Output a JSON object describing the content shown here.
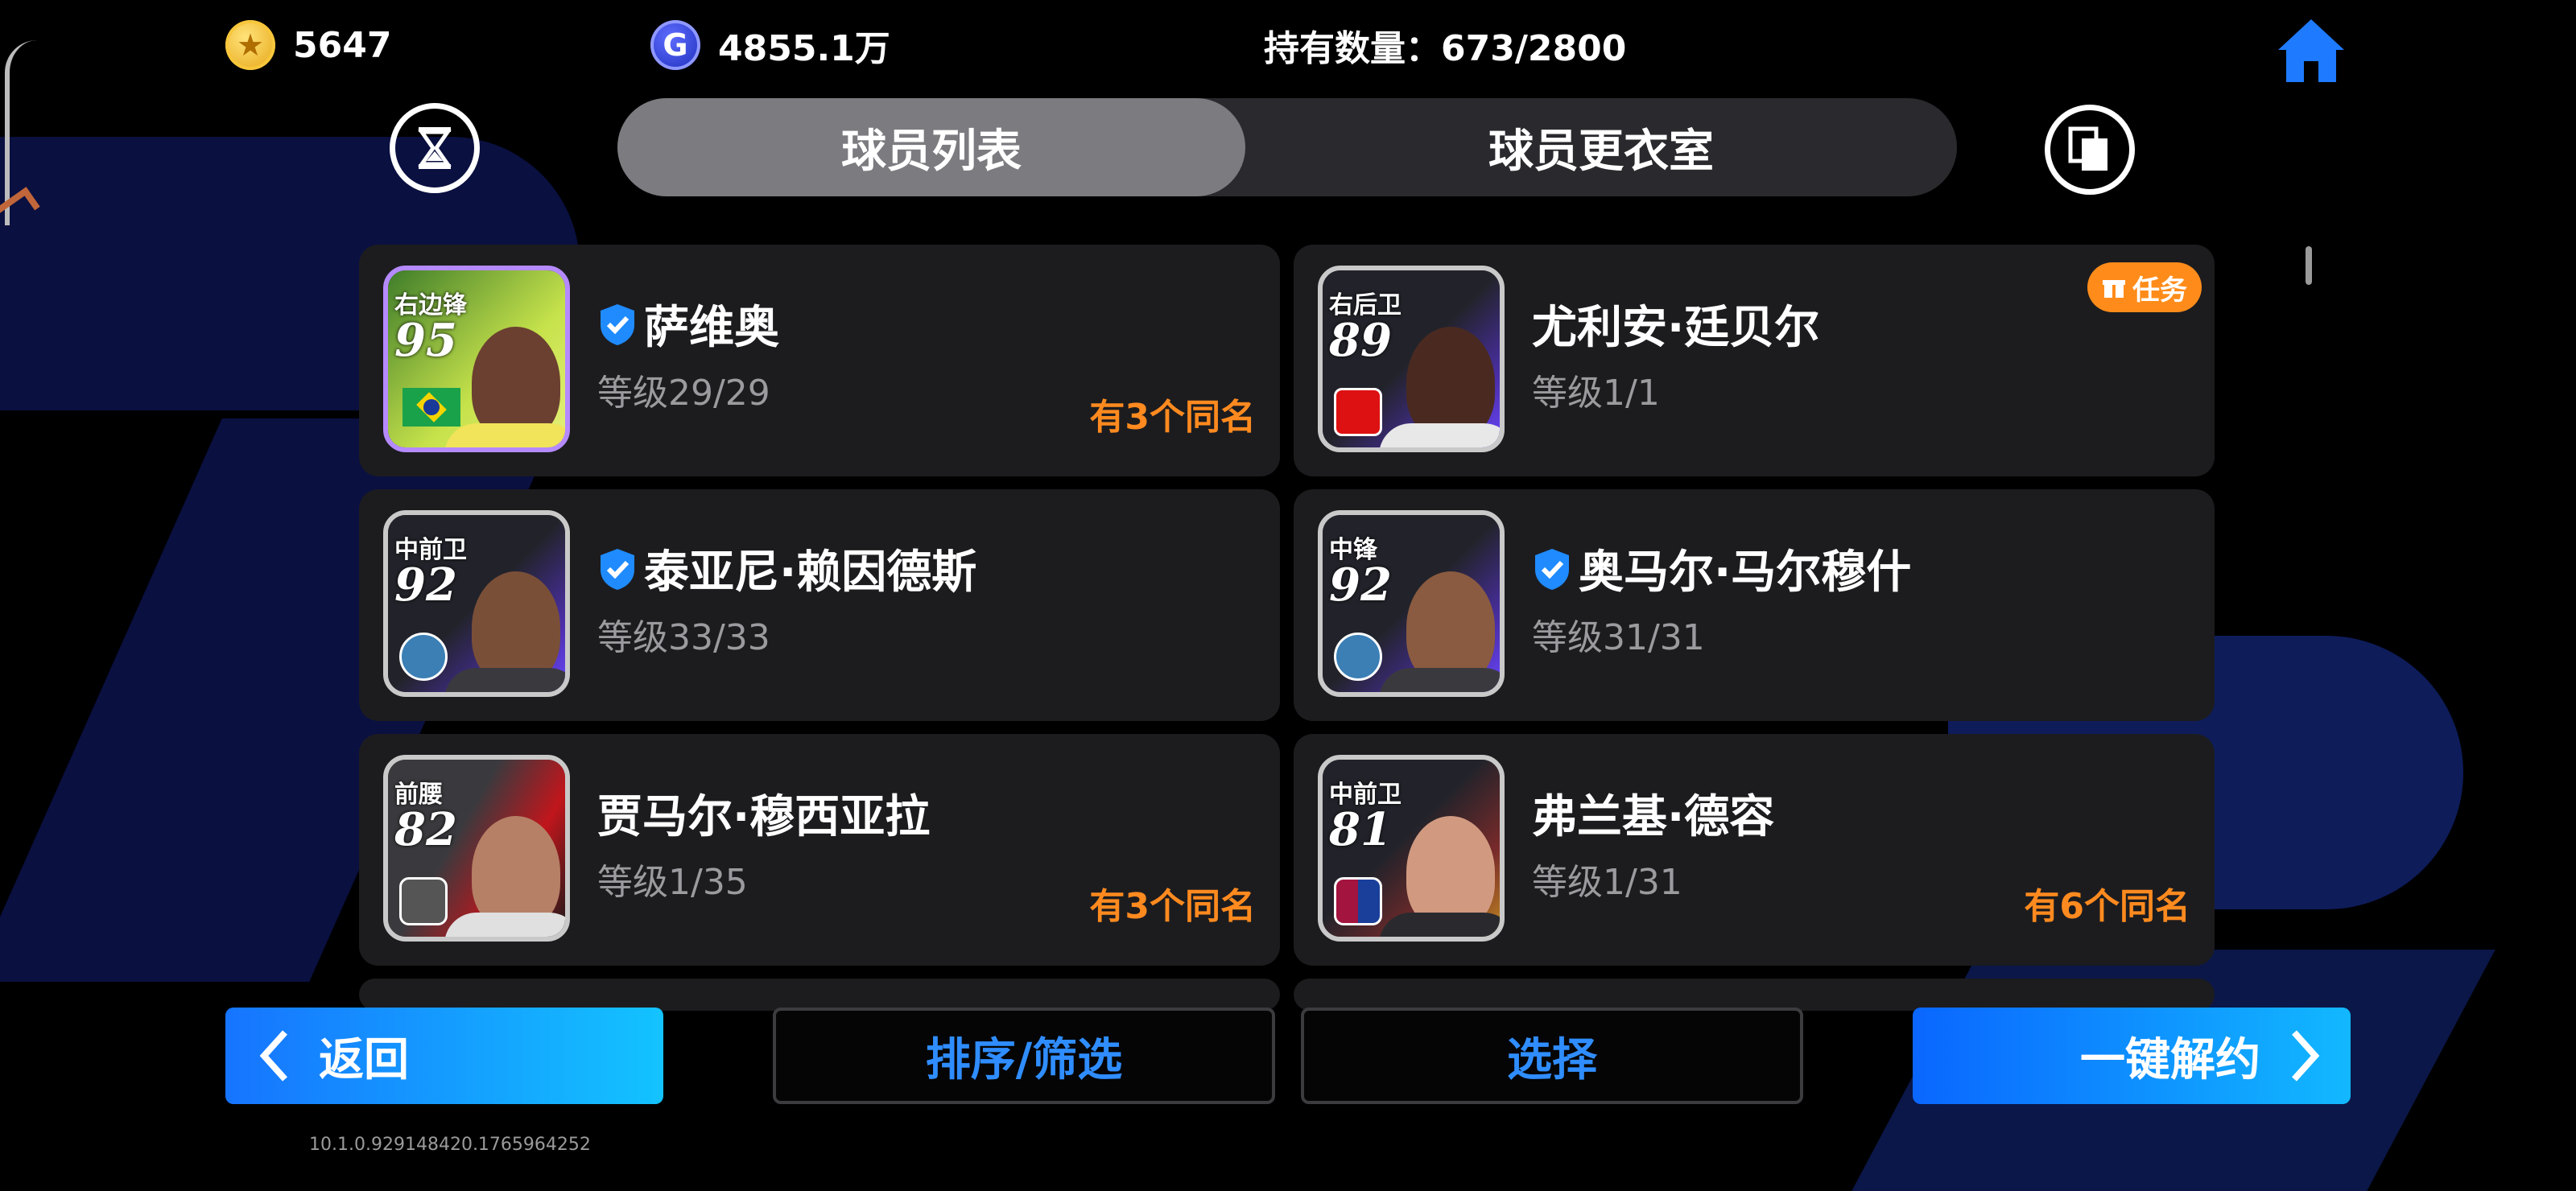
{
  "topbar": {
    "coins": "5647",
    "gp": "4855.1万",
    "holdings": "持有数量：673/2800",
    "coin_glyph": "★",
    "gp_glyph": "G"
  },
  "tabs": [
    {
      "label": "球员列表",
      "active": true
    },
    {
      "label": "球员更衣室",
      "active": false
    }
  ],
  "players": [
    {
      "position": "右边锋",
      "rating": "95",
      "name": "萨维奥",
      "verified": true,
      "level": "等级29/29",
      "duplicates": "有3个同名",
      "mission": ""
    },
    {
      "position": "右后卫",
      "rating": "89",
      "name": "尤利安·廷贝尔",
      "verified": false,
      "level": "等级1/1",
      "duplicates": "",
      "mission": "任务"
    },
    {
      "position": "中前卫",
      "rating": "92",
      "name": "泰亚尼·赖因德斯",
      "verified": true,
      "level": "等级33/33",
      "duplicates": "",
      "mission": ""
    },
    {
      "position": "中锋",
      "rating": "92",
      "name": "奥马尔·马尔穆什",
      "verified": true,
      "level": "等级31/31",
      "duplicates": "",
      "mission": ""
    },
    {
      "position": "前腰",
      "rating": "82",
      "name": "贾马尔·穆西亚拉",
      "verified": false,
      "level": "等级1/35",
      "duplicates": "有3个同名",
      "mission": ""
    },
    {
      "position": "中前卫",
      "rating": "81",
      "name": "弗兰基·德容",
      "verified": false,
      "level": "等级1/31",
      "duplicates": "有6个同名",
      "mission": ""
    }
  ],
  "buttons": {
    "back": "返回",
    "sort_filter": "排序/筛选",
    "select": "选择",
    "release_all": "一键解约"
  },
  "version": "10.1.0.929148420.1765964252",
  "colors": {
    "accent_orange": "#ff8a1f",
    "accent_blue": "#2f8dff",
    "card_bg": "#1c1c1f"
  },
  "icons": {
    "home": "home-icon",
    "timer": "hourglass-icon",
    "copy": "copy-icon",
    "verified": "shield-check-icon",
    "gift": "gift-icon",
    "back": "chevron-left-icon",
    "next": "chevron-right-icon"
  }
}
